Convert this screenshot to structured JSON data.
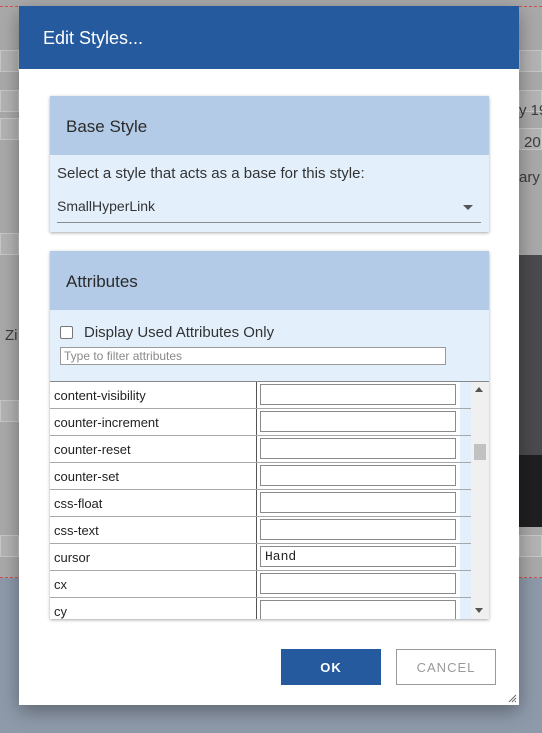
{
  "background": {
    "fragments": [
      "Zi",
      "y 19",
      "20",
      "ary"
    ]
  },
  "dialog": {
    "title": "Edit Styles..."
  },
  "base_style": {
    "heading": "Base Style",
    "description": "Select a style that acts as a base for this style:",
    "selected": "SmallHyperLink"
  },
  "attributes": {
    "heading": "Attributes",
    "filter_checkbox_label": "Display Used Attributes Only",
    "filter_placeholder": "Type to filter attributes",
    "rows": [
      {
        "name": "content-visibility",
        "value": ""
      },
      {
        "name": "counter-increment",
        "value": ""
      },
      {
        "name": "counter-reset",
        "value": ""
      },
      {
        "name": "counter-set",
        "value": ""
      },
      {
        "name": "css-float",
        "value": ""
      },
      {
        "name": "css-text",
        "value": ""
      },
      {
        "name": "cursor",
        "value": "Hand"
      },
      {
        "name": "cx",
        "value": ""
      },
      {
        "name": "cy",
        "value": ""
      }
    ]
  },
  "buttons": {
    "ok": "OK",
    "cancel": "CANCEL"
  },
  "colors": {
    "header": "#265a9e",
    "panel_head": "#b3cbe6",
    "panel_body": "#e3f0fc"
  }
}
